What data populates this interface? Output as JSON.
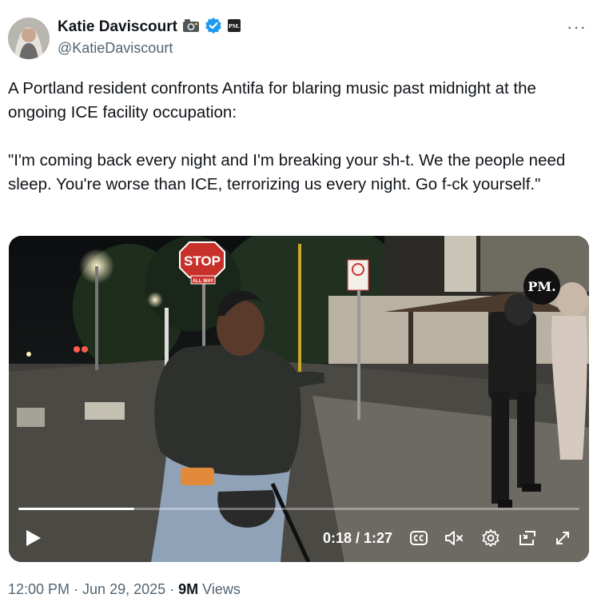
{
  "author": {
    "display_name": "Katie Daviscourt",
    "handle": "@KatieDaviscourt",
    "emoji_badge": "camera-icon",
    "verified_color": "#1d9bf0",
    "affiliate_badge": "PM."
  },
  "more_menu": "···",
  "tweet": {
    "text": "A Portland resident confronts Antifa for blaring music past midnight at the ongoing ICE facility occupation:\n\n\"I'm coming back every night and I'm breaking your sh-t. We the people need sleep. You're worse than ICE, terrorizing us every night. Go f-ck yourself.\""
  },
  "video": {
    "watermark": "PM.",
    "sign_text": "STOP",
    "sign_subtext": "ALL WAY",
    "time_display": "0:18 / 1:27",
    "progress_fraction": 0.207,
    "controls": [
      "play-icon",
      "captions-icon",
      "mute-icon",
      "settings-icon",
      "pip-icon",
      "fullscreen-icon"
    ]
  },
  "footer": {
    "time": "12:00 PM",
    "sep1": " · ",
    "date": "Jun 29, 2025",
    "sep2": " · ",
    "views_count": "9M",
    "views_label": " Views"
  }
}
